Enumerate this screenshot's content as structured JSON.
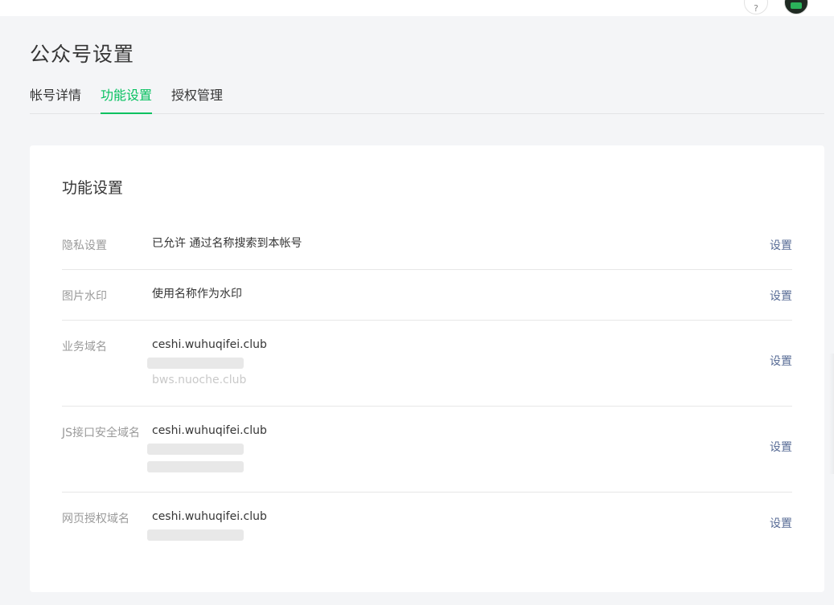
{
  "page_title": "公众号设置",
  "tabs": [
    {
      "label": "帐号详情",
      "active": false
    },
    {
      "label": "功能设置",
      "active": true
    },
    {
      "label": "授权管理",
      "active": false
    }
  ],
  "card": {
    "title": "功能设置",
    "rows": [
      {
        "label": "隐私设置",
        "values": [
          "已允许 通过名称搜索到本帐号"
        ],
        "action": "设置"
      },
      {
        "label": "图片水印",
        "values": [
          "使用名称作为水印"
        ],
        "action": "设置"
      },
      {
        "label": "业务域名",
        "values": [
          "ceshi.wuhuqifei.club",
          "",
          "bws.nuoche.club"
        ],
        "action": "设置"
      },
      {
        "label": "JS接口安全域名",
        "values": [
          "ceshi.wuhuqifei.club",
          "",
          ""
        ],
        "action": "设置"
      },
      {
        "label": "网页授权域名",
        "values": [
          "ceshi.wuhuqifei.club",
          ""
        ],
        "action": "设置"
      }
    ]
  },
  "colors": {
    "accent": "#07c160",
    "link": "#576b95",
    "label": "#9a9a9a",
    "background": "#f4f5f7"
  },
  "icons": [
    "help-icon",
    "avatar"
  ]
}
